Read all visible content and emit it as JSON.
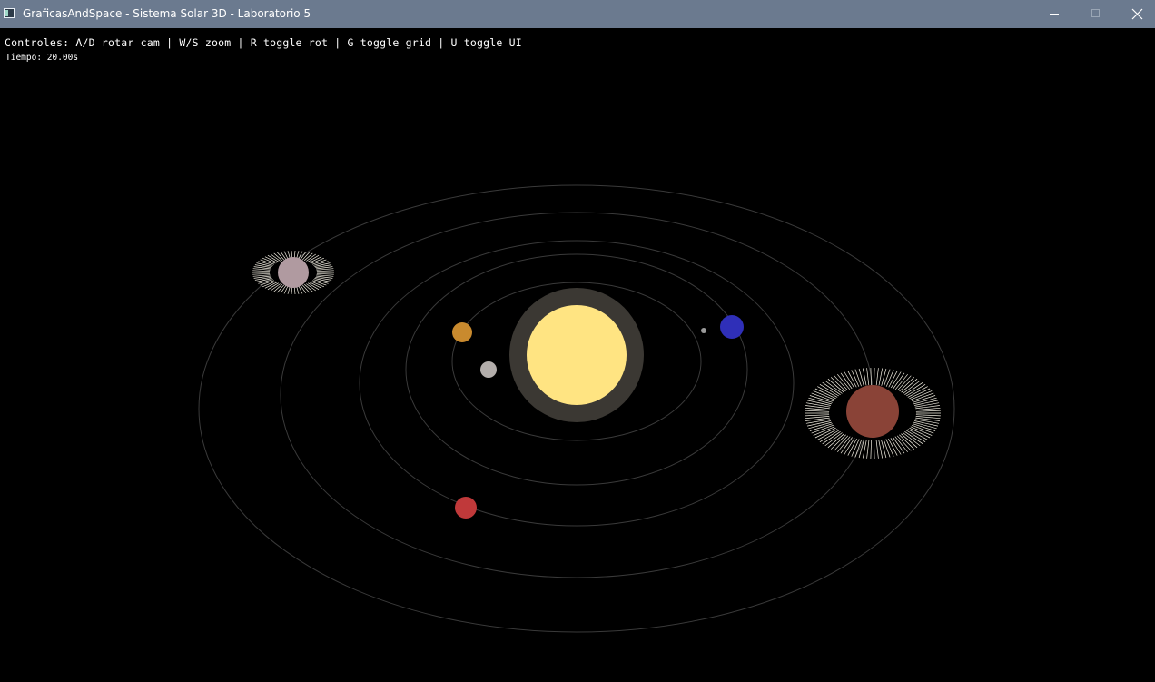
{
  "window": {
    "title": "GraficasAndSpace - Sistema Solar 3D - Laboratorio 5",
    "icon": "app-window-icon",
    "buttons": [
      "minimize-icon",
      "maximize-icon",
      "close-icon"
    ]
  },
  "hud": {
    "controls": "Controles: A/D rotar cam | W/S zoom | R toggle rot | G toggle grid | U toggle UI",
    "time": "Tiempo: 20.00s"
  },
  "colors": {
    "background": "#000000",
    "titlebar": "#6b7a8f",
    "orbit": "#3a3a3a",
    "sun_core": "#ffe482",
    "sun_halo": "#3b3833",
    "planet_gray": "#b3aeab",
    "planet_orange": "#c98a2e",
    "planet_blue": "#2f2fb8",
    "planet_red": "#c0393a",
    "planet_pinkgray": "#b09aa0",
    "planet_brownred": "#8a4337",
    "moon": "#9a9a9a",
    "rings": "#f3efe2"
  }
}
